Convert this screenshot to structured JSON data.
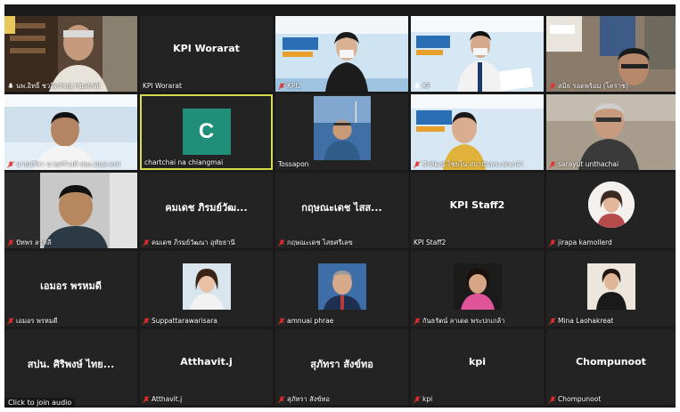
{
  "tiles": [
    {
      "id": "t1",
      "name": "นพ.อิทธิ์ ชวลิตรัชญ์ (ชัยศักดิ์)",
      "muted": false
    },
    {
      "id": "t2",
      "caption": "KPI Worarat",
      "name": "KPI Worarat",
      "muted": false
    },
    {
      "id": "t3",
      "name": "KPI2",
      "muted": true,
      "screen_title": "การมีส่วนร่วม",
      "screen_brand": "สถาบันพระปกเกล้า"
    },
    {
      "id": "t4",
      "name": "KP",
      "muted": false,
      "screen_title": "การมีส่วนร่วม",
      "screen_brand": "สถาบันพระปกเกล้า"
    },
    {
      "id": "t5",
      "name": "สมิธ รอดพร้อม (โคราช)",
      "muted": true
    },
    {
      "id": "t6",
      "name": "นายปรีชา  ฉายศรีวงศ์ สนง.คมส.สปร",
      "muted": true,
      "screen_brand": "สถาบันพระปกเกล้า"
    },
    {
      "id": "t7",
      "avatar": "C",
      "name": "chartchai na chiangmai",
      "muted": false,
      "active": true
    },
    {
      "id": "t8",
      "name": "Tossapon",
      "muted": false
    },
    {
      "id": "t9",
      "name": "ธีรพัฒน์  ไชยโน สถาบันพระปกเกล้า",
      "muted": true,
      "screen_title": "การมีส่วนร่วม",
      "screen_brand": "สถาบันพระปกเกล้า"
    },
    {
      "id": "t10",
      "name": "sarayut unthachai",
      "muted": true
    },
    {
      "id": "t11",
      "name": "ปัทพร ลาหลี",
      "muted": true
    },
    {
      "id": "t12",
      "caption": "คมเดช  ภิรมย์วัฒ...",
      "name": "คมเดช  ภิรมย์วัฒนา  อุทัยธานี",
      "muted": true
    },
    {
      "id": "t13",
      "caption": "กฤษณะเดช  ไสส...",
      "name": "กฤษณะเดช  ไสยศรีเลข",
      "muted": true
    },
    {
      "id": "t14",
      "caption": "KPI Staff2",
      "name": "KPI Staff2",
      "muted": false
    },
    {
      "id": "t15",
      "name": "jirapa kamollerd",
      "muted": true
    },
    {
      "id": "t16",
      "caption": "เอมอร  พรหมดี",
      "name": "เอมอร  พรหมดี",
      "muted": true
    },
    {
      "id": "t17",
      "name": "Suppattarawarisara",
      "muted": true
    },
    {
      "id": "t18",
      "name": "amnuai phrae",
      "muted": true
    },
    {
      "id": "t19",
      "name": "กันธรัตน์ ลาเดด พระปกเกล้า",
      "muted": true
    },
    {
      "id": "t20",
      "name": "Mina Laohakreat",
      "muted": true
    },
    {
      "id": "t21",
      "caption": "สปน. ศิริพงษ์ ไทย...",
      "name": "",
      "muted": false
    },
    {
      "id": "t22",
      "caption": "Atthavit.j",
      "name": "Atthavit.j",
      "muted": true
    },
    {
      "id": "t23",
      "caption": "สุภัทรา สังข์ทอ",
      "name": "สุภัทรา  สังข์ทอ",
      "muted": true
    },
    {
      "id": "t24",
      "caption": "kpi",
      "name": "kpi",
      "muted": true
    },
    {
      "id": "t25",
      "caption": "Chompunoot",
      "name": "Chompunoot",
      "muted": true
    }
  ],
  "footer": {
    "click_audio": "Click to join audio"
  },
  "colors": {
    "mute": "#e0312e",
    "active_border": "#d7dc4a",
    "avatar_bg": "#1f8f7a"
  }
}
